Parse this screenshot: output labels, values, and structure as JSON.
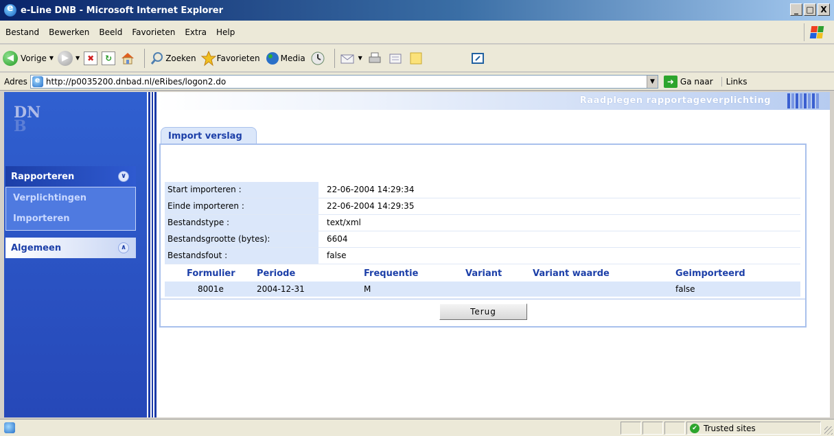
{
  "window": {
    "title": "e-Line DNB - Microsoft Internet Explorer",
    "btn_min": "_",
    "btn_max": "□",
    "btn_close": "X"
  },
  "menu": [
    "Bestand",
    "Bewerken",
    "Beeld",
    "Favorieten",
    "Extra",
    "Help"
  ],
  "toolbar": {
    "back": "Vorige",
    "search": "Zoeken",
    "favorites": "Favorieten",
    "media": "Media"
  },
  "address": {
    "label": "Adres",
    "url": "http://p0035200.dnbad.nl/eRibes/logon2.do",
    "go": "Ga naar",
    "links": "Links"
  },
  "sidebar": {
    "logo_top": "DN",
    "logo_bottom": "B",
    "rapporteren": "Rapporteren",
    "items": [
      "Verplichtingen",
      "Importeren"
    ],
    "algemeen": "Algemeen"
  },
  "header": {
    "page_title": "Raadplegen rapportageverplichting"
  },
  "tab": {
    "label": "Import verslag"
  },
  "info": [
    {
      "label": "Start importeren :",
      "value": "22-06-2004 14:29:34"
    },
    {
      "label": "Einde importeren :",
      "value": "22-06-2004 14:29:35"
    },
    {
      "label": "Bestandstype :",
      "value": "text/xml"
    },
    {
      "label": "Bestandsgrootte (bytes):",
      "value": "6604"
    },
    {
      "label": "Bestandsfout :",
      "value": "false"
    }
  ],
  "table": {
    "headers": [
      "Formulier",
      "Periode",
      "Frequentie",
      "Variant",
      "Variant waarde",
      "Geimporteerd"
    ],
    "rows": [
      {
        "formulier": "8001e",
        "periode": "2004-12-31",
        "frequentie": "M",
        "variant": "",
        "variant_waarde": "",
        "geimporteerd": "false"
      }
    ]
  },
  "buttons": {
    "back": "Terug"
  },
  "status": {
    "zone": "Trusted sites"
  },
  "colors": {
    "accent": "#1c3fa8",
    "panel_label_bg": "#dbe7fa",
    "title_bar": "#0a246a"
  }
}
